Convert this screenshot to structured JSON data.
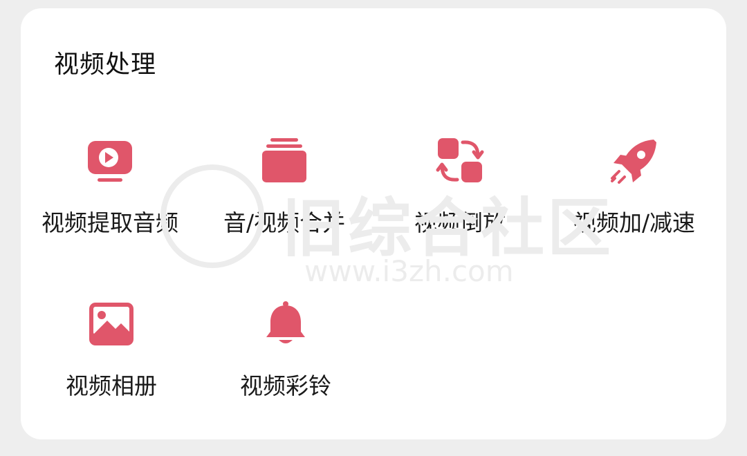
{
  "section": {
    "title": "视频处理"
  },
  "tools": [
    {
      "label": "视频提取音频",
      "icon": "play-video-icon"
    },
    {
      "label": "音/视频合并",
      "icon": "stack-layers-icon"
    },
    {
      "label": "视频倒放",
      "icon": "swap-reverse-icon"
    },
    {
      "label": "视频加/减速",
      "icon": "rocket-icon"
    },
    {
      "label": "视频相册",
      "icon": "image-album-icon"
    },
    {
      "label": "视频彩铃",
      "icon": "bell-icon"
    }
  ],
  "watermark": {
    "logo_text": "旧综合社区",
    "url": "www.i3zh.com"
  },
  "colors": {
    "accent": "#e0566a",
    "background": "#eeeeee",
    "card": "#ffffff",
    "text": "#1a1a1a"
  }
}
